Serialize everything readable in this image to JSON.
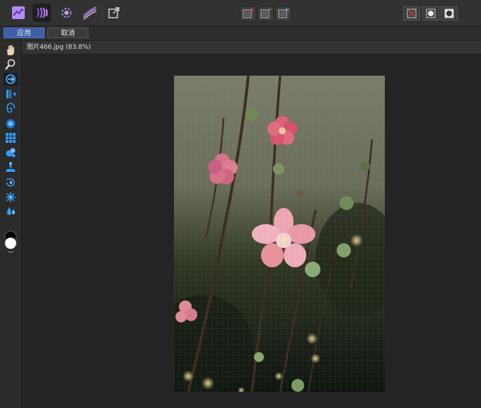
{
  "toolbar": {
    "left_tools": [
      "develop-persona-icon",
      "liquify-persona-icon",
      "tone-mapping-icon",
      "curves-persona-icon",
      "export-persona-icon"
    ],
    "active_tool": "liquify-persona-icon",
    "middle_tools": [
      "mesh-clip-icon",
      "mesh-freeze-icon",
      "mesh-reset-icon"
    ],
    "right_tools": [
      "close-mask-icon",
      "show-mask-icon",
      "invert-mask-icon"
    ]
  },
  "actions": {
    "apply_label": "应用",
    "cancel_label": "取消"
  },
  "document": {
    "tab_title": "图片466.jpg (83.8%)"
  },
  "sidebar": {
    "tools": [
      "hand-icon",
      "zoom-icon",
      "push-forward-icon",
      "push-left-icon",
      "twirl-icon",
      "pinch-icon",
      "mesh-grid-icon",
      "turbulence-icon",
      "freeze-icon",
      "reconstruct-icon",
      "mesh-pin-icon",
      "melt-icon"
    ],
    "active_tool": "push-forward-icon"
  },
  "colors": {
    "accent": "#3c5fa8",
    "tool_blue": "#2e9cff",
    "background": "#242424",
    "grid": "#8c9a55"
  }
}
